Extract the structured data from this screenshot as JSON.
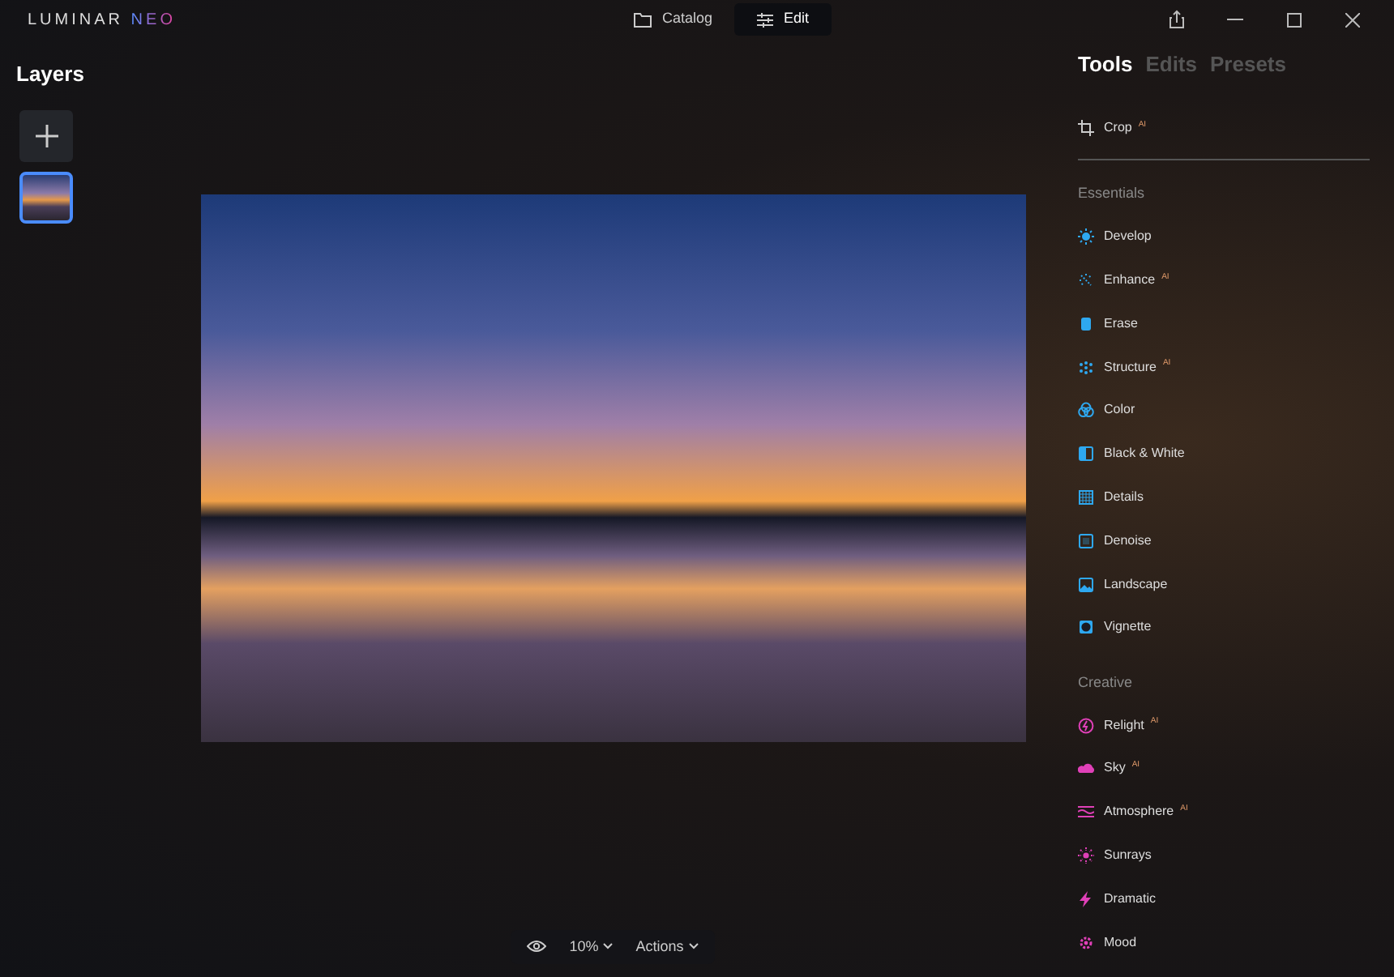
{
  "app": {
    "logo_left": "LUMINAR ",
    "logo_right": "NEO"
  },
  "nav": [
    {
      "label": "Catalog",
      "selected": false
    },
    {
      "label": "Edit",
      "selected": true
    }
  ],
  "layers": {
    "title": "Layers"
  },
  "tabs": [
    {
      "label": "Tools",
      "selected": true
    },
    {
      "label": "Edits",
      "selected": false
    },
    {
      "label": "Presets",
      "selected": false
    }
  ],
  "crop": {
    "label": "Crop",
    "badge": "AI"
  },
  "sections": [
    {
      "title": "Essentials",
      "kind": "essentials",
      "items": [
        {
          "label": "Develop"
        },
        {
          "label": "Enhance",
          "badge": "AI"
        },
        {
          "label": "Erase"
        },
        {
          "label": "Structure",
          "badge": "AI"
        },
        {
          "label": "Color"
        },
        {
          "label": "Black & White"
        },
        {
          "label": "Details"
        },
        {
          "label": "Denoise"
        },
        {
          "label": "Landscape"
        },
        {
          "label": "Vignette"
        }
      ]
    },
    {
      "title": "Creative",
      "kind": "creative",
      "items": [
        {
          "label": "Relight",
          "badge": "AI"
        },
        {
          "label": "Sky",
          "badge": "AI"
        },
        {
          "label": "Atmosphere",
          "badge": "AI"
        },
        {
          "label": "Sunrays"
        },
        {
          "label": "Dramatic"
        },
        {
          "label": "Mood"
        }
      ]
    }
  ],
  "bottom": {
    "zoom": "10%",
    "actions": "Actions"
  }
}
